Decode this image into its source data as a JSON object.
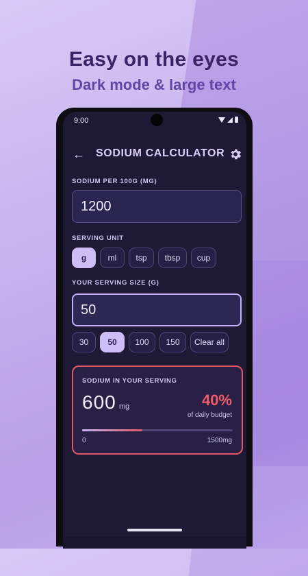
{
  "promo": {
    "headline": "Easy on the eyes",
    "subline": "Dark mode & large text"
  },
  "status": {
    "time": "9:00",
    "icons": [
      "wifi-icon",
      "signal-icon",
      "battery-icon"
    ]
  },
  "appbar": {
    "title": "SODIUM CALCULATOR",
    "back_icon": "arrow-back-icon",
    "settings_icon": "gear-icon"
  },
  "sodium_per_100g": {
    "label": "SODIUM PER 100G (MG)",
    "value": "1200"
  },
  "serving_unit": {
    "label": "SERVING UNIT",
    "options": [
      "g",
      "ml",
      "tsp",
      "tbsp",
      "cup"
    ],
    "selected": "g"
  },
  "serving_size": {
    "label": "YOUR SERVING SIZE (G)",
    "value": "50",
    "presets": [
      "30",
      "50",
      "100",
      "150"
    ],
    "selected": "50",
    "clear_label": "Clear all"
  },
  "result": {
    "label": "SODIUM IN YOUR SERVING",
    "value": "600",
    "unit": "mg",
    "percent": "40%",
    "percent_caption": "of daily budget",
    "progress_fraction": 0.4,
    "axis_min": "0",
    "axis_max": "1500mg"
  },
  "colors": {
    "accent": "#cdbff5",
    "warning": "#e0566a",
    "surface": "#1e1a36"
  }
}
